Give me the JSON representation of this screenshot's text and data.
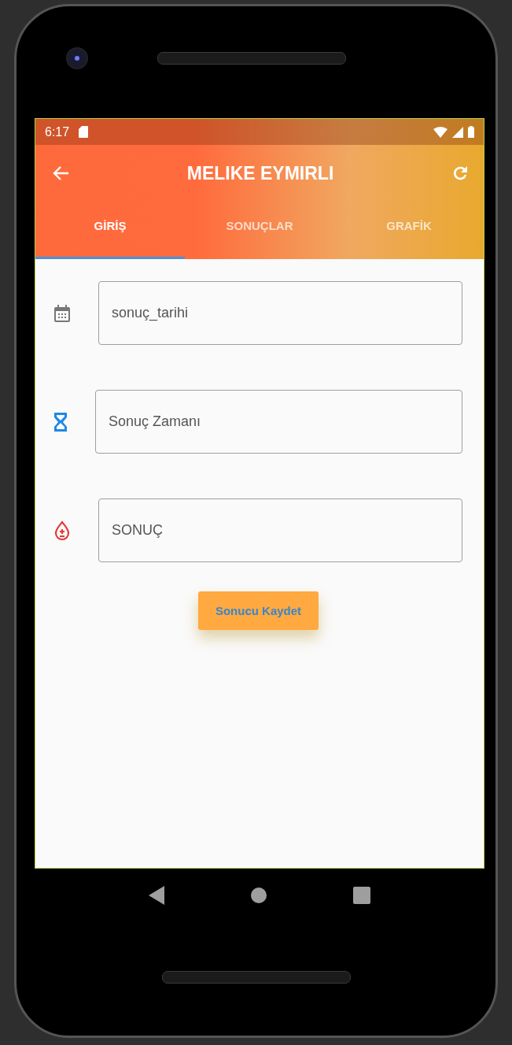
{
  "status_bar": {
    "time": "6:17"
  },
  "app_bar": {
    "title": "MELIKE EYMIRLI"
  },
  "tabs": [
    {
      "label": "GİRİŞ",
      "selected": true
    },
    {
      "label": "SONUÇLAR",
      "selected": false
    },
    {
      "label": "GRAFİK",
      "selected": false
    }
  ],
  "fields": [
    {
      "kind": "date",
      "placeholder": "sonuç_tarihi"
    },
    {
      "kind": "time",
      "placeholder": "Sonuç Zamanı"
    },
    {
      "kind": "result",
      "placeholder": "SONUÇ"
    }
  ],
  "save_button": {
    "label": "Sonucu Kaydet"
  }
}
